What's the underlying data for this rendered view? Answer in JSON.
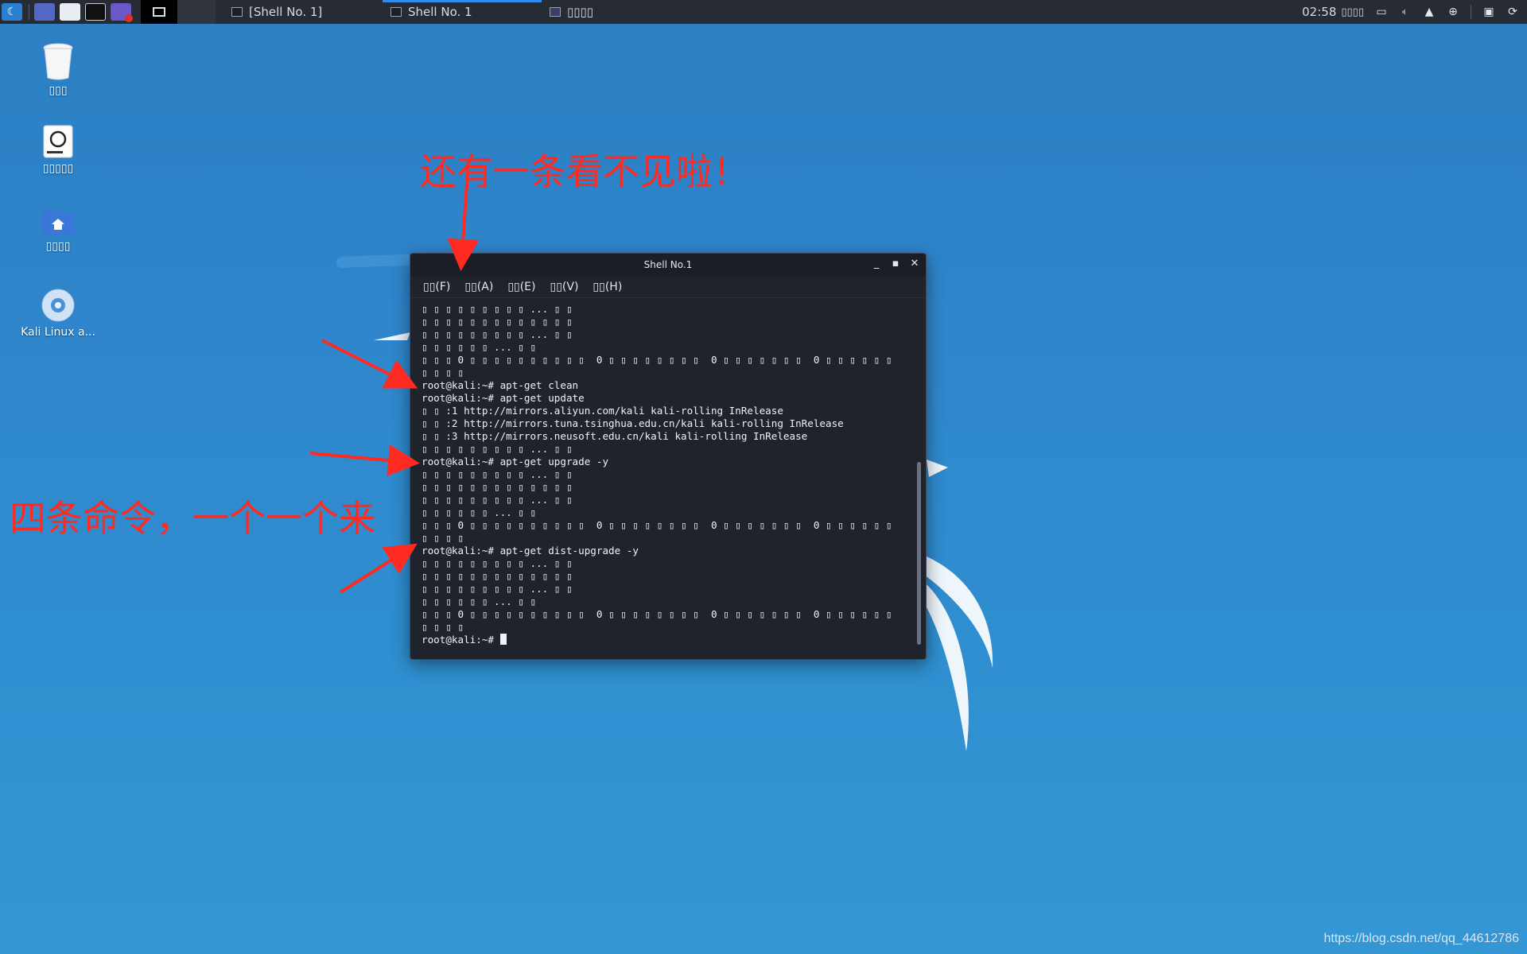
{
  "taskbar": {
    "tasks": [
      {
        "label": "[Shell No. 1]",
        "active": false
      },
      {
        "label": "Shell No. 1",
        "active": true
      },
      {
        "label": "▯▯▯▯",
        "active": false
      }
    ],
    "clock": "02:58",
    "tray_glyph": "▯▯▯▯",
    "tray_icons": [
      "display-icon",
      "volume-icon",
      "bell-icon",
      "network-icon",
      "lock-icon",
      "logout-icon"
    ]
  },
  "desktop": {
    "icons": [
      {
        "name": "trash",
        "label": "▯▯▯"
      },
      {
        "name": "filesystem",
        "label": "▯▯▯▯▯"
      },
      {
        "name": "home-folder",
        "label": "▯▯▯▯"
      },
      {
        "name": "kali-disc",
        "label": "Kali Linux a..."
      }
    ]
  },
  "terminal": {
    "title": "Shell No.1",
    "menu": [
      "▯▯(F)",
      "▯▯(A)",
      "▯▯(E)",
      "▯▯(V)",
      "▯▯(H)"
    ],
    "lines": [
      "▯ ▯ ▯ ▯ ▯ ▯ ▯ ▯ ▯ ... ▯ ▯",
      "▯ ▯ ▯ ▯ ▯ ▯ ▯ ▯ ▯ ▯ ▯ ▯ ▯",
      "▯ ▯ ▯ ▯ ▯ ▯ ▯ ▯ ▯ ... ▯ ▯",
      "▯ ▯ ▯ ▯ ▯ ▯ ... ▯ ▯",
      "▯ ▯ ▯ 0 ▯ ▯ ▯ ▯ ▯ ▯ ▯ ▯ ▯ ▯  0 ▯ ▯ ▯ ▯ ▯ ▯ ▯ ▯  0 ▯ ▯ ▯ ▯ ▯ ▯ ▯  0 ▯ ▯ ▯ ▯ ▯ ▯",
      "▯ ▯ ▯ ▯",
      "root@kali:~# apt-get clean",
      "root@kali:~# apt-get update",
      "▯ ▯ :1 http://mirrors.aliyun.com/kali kali-rolling InRelease",
      "▯ ▯ :2 http://mirrors.tuna.tsinghua.edu.cn/kali kali-rolling InRelease",
      "▯ ▯ :3 http://mirrors.neusoft.edu.cn/kali kali-rolling InRelease",
      "▯ ▯ ▯ ▯ ▯ ▯ ▯ ▯ ▯ ... ▯ ▯",
      "root@kali:~# apt-get upgrade -y",
      "▯ ▯ ▯ ▯ ▯ ▯ ▯ ▯ ▯ ... ▯ ▯",
      "▯ ▯ ▯ ▯ ▯ ▯ ▯ ▯ ▯ ▯ ▯ ▯ ▯",
      "▯ ▯ ▯ ▯ ▯ ▯ ▯ ▯ ▯ ... ▯ ▯",
      "▯ ▯ ▯ ▯ ▯ ▯ ... ▯ ▯",
      "▯ ▯ ▯ 0 ▯ ▯ ▯ ▯ ▯ ▯ ▯ ▯ ▯ ▯  0 ▯ ▯ ▯ ▯ ▯ ▯ ▯ ▯  0 ▯ ▯ ▯ ▯ ▯ ▯ ▯  0 ▯ ▯ ▯ ▯ ▯ ▯",
      "▯ ▯ ▯ ▯",
      "root@kali:~# apt-get dist-upgrade -y",
      "▯ ▯ ▯ ▯ ▯ ▯ ▯ ▯ ▯ ... ▯ ▯",
      "▯ ▯ ▯ ▯ ▯ ▯ ▯ ▯ ▯ ▯ ▯ ▯ ▯",
      "▯ ▯ ▯ ▯ ▯ ▯ ▯ ▯ ▯ ... ▯ ▯",
      "▯ ▯ ▯ ▯ ▯ ▯ ... ▯ ▯",
      "▯ ▯ ▯ 0 ▯ ▯ ▯ ▯ ▯ ▯ ▯ ▯ ▯ ▯  0 ▯ ▯ ▯ ▯ ▯ ▯ ▯ ▯  0 ▯ ▯ ▯ ▯ ▯ ▯ ▯  0 ▯ ▯ ▯ ▯ ▯ ▯",
      "▯ ▯ ▯ ▯"
    ],
    "prompt": "root@kali:~# "
  },
  "annotations": {
    "top_note": "还有一条看不见啦！",
    "left_note": "四条命令，一个一个来"
  },
  "watermark": "https://blog.csdn.net/qq_44612786",
  "colors": {
    "annotation_red": "#ff2a22",
    "taskbar_bg": "#272b33",
    "terminal_bg": "#1f232b",
    "active_tab_accent": "#2d8cf0"
  }
}
